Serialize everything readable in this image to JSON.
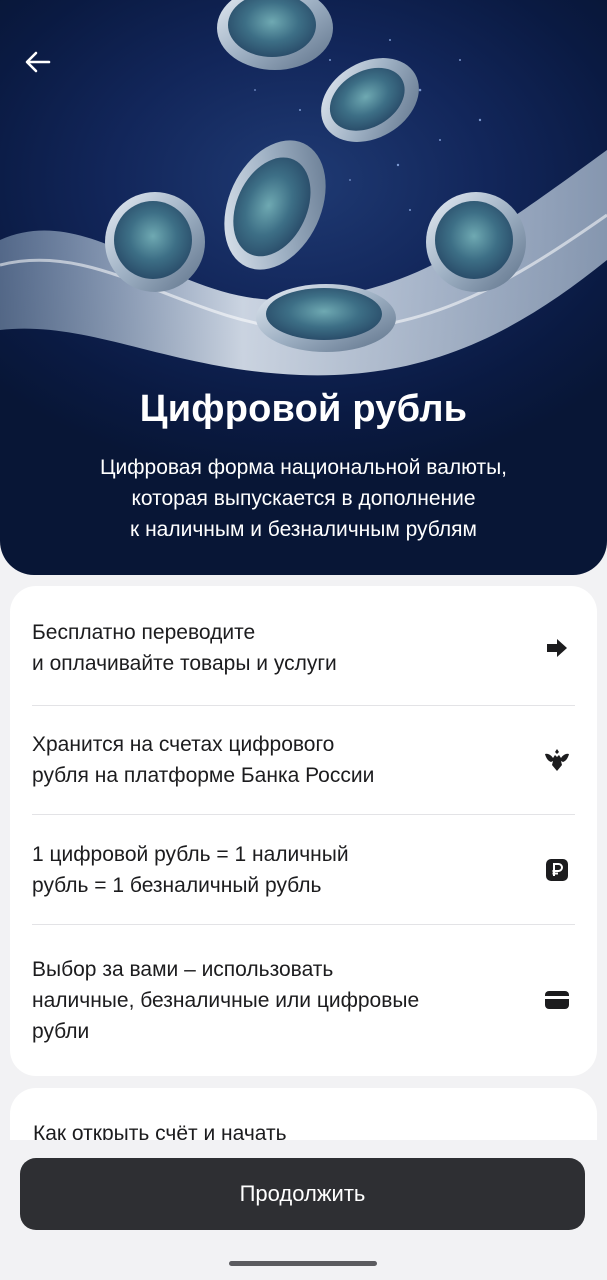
{
  "hero": {
    "title": "Цифровой рубль",
    "subtitle_lines": [
      "Цифровая форма национальной валюты,",
      "которая выпускается в дополнение",
      "к наличным и безналичным рублям"
    ],
    "back_icon": "arrow-left-icon"
  },
  "features": [
    {
      "lines": [
        "Бесплатно переводите",
        "и оплачивайте товары и услуги"
      ],
      "icon": "arrow-right-icon"
    },
    {
      "lines": [
        "Хранится на счетах цифрового",
        "рубля на платформе Банка России"
      ],
      "icon": "bank-of-russia-eagle-icon"
    },
    {
      "lines": [
        "1 цифровой рубль = 1 наличный",
        "рубль = 1 безналичный рубль"
      ],
      "icon": "ruble-icon"
    },
    {
      "lines": [
        "Выбор за вами – использовать",
        "наличные, безналичные или цифровые",
        "рубли"
      ],
      "icon": "card-icon"
    }
  ],
  "next_card": {
    "text": "Как открыть счёт и начать"
  },
  "cta": {
    "label": "Продолжить"
  },
  "colors": {
    "hero_bg": "#12265a",
    "cta_bg": "#2e2f33",
    "page_bg": "#f2f2f4"
  }
}
